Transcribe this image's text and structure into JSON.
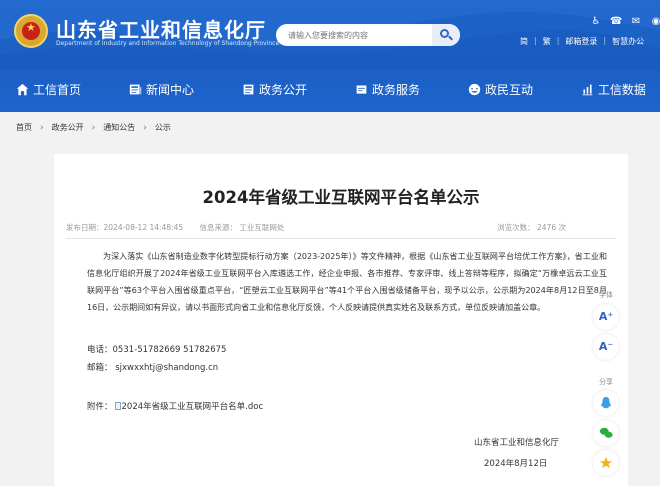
{
  "header": {
    "site_title": "山东省工业和信息化厅",
    "site_subtitle": "Department of Industry and Information Technology of Shandong Province",
    "search_placeholder": "请输入您要搜索的内容",
    "tool_icons": [
      "♿",
      "☎",
      "✉",
      "◉"
    ],
    "tool_links": [
      "简",
      "繁",
      "邮箱登录",
      "智慧办公"
    ]
  },
  "nav": {
    "items": [
      {
        "label": "工信首页",
        "icon": "home-icon"
      },
      {
        "label": "新闻中心",
        "icon": "news-icon"
      },
      {
        "label": "政务公开",
        "icon": "gov-icon"
      },
      {
        "label": "政务服务",
        "icon": "service-icon"
      },
      {
        "label": "政民互动",
        "icon": "interact-icon"
      },
      {
        "label": "工信数据",
        "icon": "data-icon"
      }
    ]
  },
  "breadcrumb": [
    "首页",
    "政务公开",
    "通知公告",
    "公示"
  ],
  "article": {
    "title": "2024年省级工业互联网平台名单公示",
    "publish_time": "发布日期：2024-08-12 14:48:45",
    "source": "信息来源：  工业互联网处",
    "views": "浏览次数：  2476     次",
    "intro": "为深入落实《山东省制造业数字化转型提标行动方案（2023-2025年）》等文件精神，根据《山东省工业互联网平台培优工作方案》，省工业和信息化厅组织开展了2024年省级工业互联网平台入库遴选工作，经企业申报、各市推荐、专家评审、线上答辩等程序，拟确定“万橡卓远云工业互联网平台”等63个平台入围省级重点平台，“匠塑云工业互联网平台”等41个平台入围省级储备平台，现予以公示，公示期为2024年8月12日至8月16日，公示期间如有异议，请以书面形式向省工业和信息化厅反馈，个人反映请提供真实姓名及联系方式，单位反映请加盖公章。",
    "phone": "电话：0531-51782669 51782675",
    "email": "邮箱：  sjxwxxhtj@shandong.cn",
    "attachment_label": "附件：",
    "attachment_file": "2024年省级工业互联网平台名单.doc",
    "signature_org": "山东省工业和信息化厅",
    "signature_date": "2024年8月12日"
  },
  "float_toolbar": {
    "font_label": "字体",
    "font_up": "A⁺",
    "font_down": "A⁻",
    "share_label": "分享"
  },
  "colors": {
    "header_blue": "#1d64c8",
    "page_bg": "#f2f2f2"
  }
}
